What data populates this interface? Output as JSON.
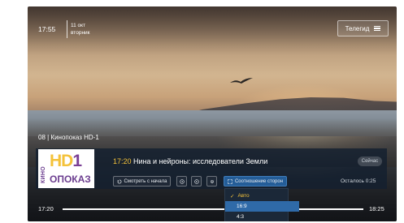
{
  "status": {
    "time": "17:55",
    "date_line1": "11 окт",
    "date_line2": "вторник"
  },
  "header": {
    "teleguide_label": "Телегид",
    "menu_icon": "menu-icon"
  },
  "channel": {
    "line": "08 | Кинопоказ HD-1",
    "logo_text_vertical": "КИНО",
    "logo_text_main": "HD",
    "logo_text_main_accent": "1",
    "logo_text_bottom": "ОПОКАЗ"
  },
  "program": {
    "start": "17:20",
    "title": "Нина и нейроны: исследователи Земли",
    "now_badge": "Сейчас",
    "remaining": "Осталось 0:25"
  },
  "controls": {
    "restart_label": "Смотреть с начала",
    "aspect_label": "Соотношение сторон"
  },
  "timeline": {
    "start": "17:20",
    "end": "18:25",
    "progress": 1.0
  },
  "aspect_menu": {
    "options": [
      "Авто",
      "16:9",
      "4:3"
    ],
    "selected": "Авто",
    "highlighted": "16:9"
  },
  "colors": {
    "accent": "#f4c23a",
    "selection": "#2f6aa8",
    "panel": "#142030"
  }
}
